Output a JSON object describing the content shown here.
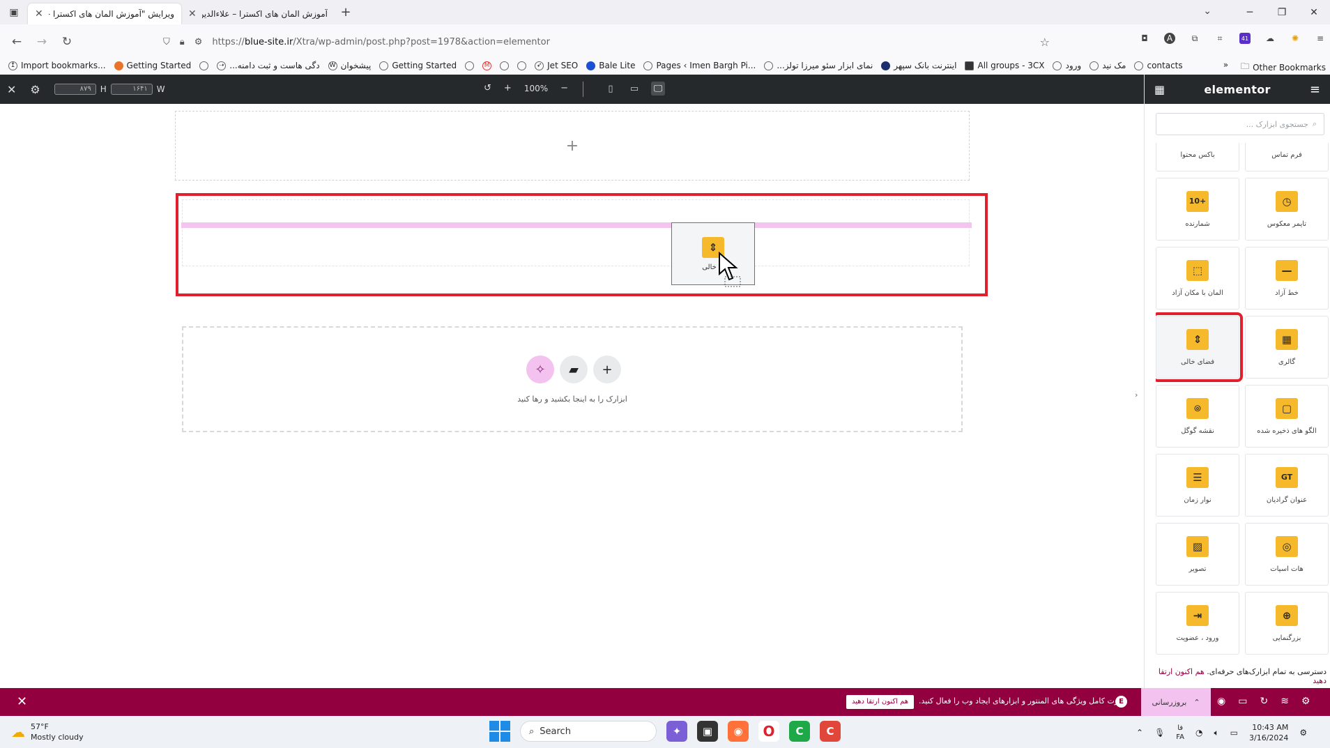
{
  "browser": {
    "tabs": [
      {
        "title": "ویرایش \"آموزش المان های اکسترا – ع",
        "active": true
      },
      {
        "title": "آموزش المان های اکسترا – علاءالدین",
        "active": false
      }
    ],
    "url_prefix": "https://",
    "url_host": "blue-site.ir",
    "url_path": "/Xtra/wp-admin/post.php?post=1978&action=elementor",
    "extension_badge": "41",
    "bookmarks": [
      "Import bookmarks...",
      "Getting Started",
      "...دگی هاست و ثبت دامنه",
      "پیشخوان",
      "Getting Started",
      "Jet SEO",
      "Bale Lite",
      "Pages ‹ Imen Bargh Pi...",
      "...نمای ابزار سئو میرزا تولز",
      "اینترنت بانک سپهر",
      "All groups - 3CX",
      "ورود",
      "مک نید",
      "contacts"
    ],
    "other_bookmarks": "Other Bookmarks"
  },
  "editor_topbar": {
    "height_label": "H",
    "height_value": "۸۷۹",
    "width_label": "W",
    "width_value": "۱۶۴۱",
    "zoom": "100%"
  },
  "canvas": {
    "add_hint": "ابزارک را به اینجا بکشید و رها کنید",
    "drag_widget_label": "ی خالی"
  },
  "panel": {
    "logo": "elementor",
    "search_placeholder": "جستجوی ابزارک ...",
    "widgets": [
      {
        "label": "فرم تماس",
        "icon": "form-icon",
        "selected": false
      },
      {
        "label": "باکس محتوا",
        "icon": "box-icon",
        "selected": false
      },
      {
        "label": "تایمر معکوس",
        "icon": "countdown-icon",
        "selected": false
      },
      {
        "label": "شمارنده",
        "icon": "counter-icon",
        "glyph": "10+",
        "selected": false
      },
      {
        "label": "خط آزاد",
        "icon": "divider-icon",
        "selected": false
      },
      {
        "label": "المان با مکان آزاد",
        "icon": "free-element-icon",
        "selected": false
      },
      {
        "label": "گالری",
        "icon": "gallery-icon",
        "selected": false
      },
      {
        "label": "فضای خالی",
        "icon": "spacer-icon",
        "selected": true
      },
      {
        "label": "الگو های ذخیره شده",
        "icon": "template-icon",
        "selected": false
      },
      {
        "label": "نقشه گوگل",
        "icon": "map-pin-icon",
        "selected": false
      },
      {
        "label": "عنوان گرادیان",
        "icon": "gradient-title-icon",
        "glyph": "GT",
        "selected": false
      },
      {
        "label": "نوار زمان",
        "icon": "timeline-icon",
        "selected": false
      },
      {
        "label": "هات اسپات",
        "icon": "hotspot-icon",
        "selected": false
      },
      {
        "label": "تصویر",
        "icon": "image-icon",
        "selected": false
      },
      {
        "label": "بزرگنمایی",
        "icon": "zoom-icon",
        "selected": false
      },
      {
        "label": "ورود ، عضویت",
        "icon": "login-icon",
        "selected": false
      }
    ],
    "promo_text": "دسترسی به تمام ابزارک‌های حرفه‌ای.",
    "promo_link": "هم اکنون ارتقا دهید"
  },
  "promo_bar": {
    "text": "قدرت کامل ویژگی های المنتور و ابزارهای ایجاد وب را فعال کنید.",
    "cta": "هم اکنون ارتقا دهید",
    "update": "بروزرسانی"
  },
  "taskbar": {
    "temperature": "57°F",
    "condition": "Mostly cloudy",
    "search": "Search",
    "lang_top": "فا",
    "lang_bottom": "FA",
    "time": "10:43 AM",
    "date": "3/16/2024"
  },
  "colors": {
    "accent_yellow": "#f7b92c",
    "highlight_red": "#e0202c",
    "promo_maroon": "#93003f",
    "drop_pink": "#f2c4ee",
    "topbar_dark": "#26292c"
  }
}
